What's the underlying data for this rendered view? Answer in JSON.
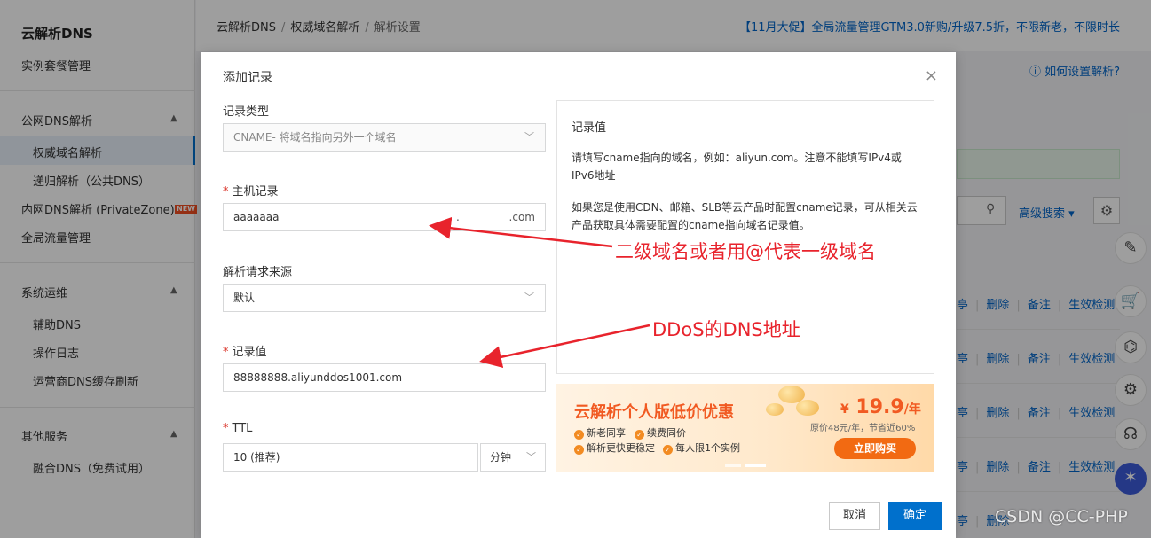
{
  "sidebar": {
    "title": "云解析DNS",
    "items": [
      {
        "label": "实例套餐管理"
      },
      {
        "label": "公网DNS解析"
      },
      {
        "label": "权威域名解析"
      },
      {
        "label": "递归解析（公共DNS）"
      },
      {
        "label": "内网DNS解析 (PrivateZone)"
      },
      {
        "label": "全局流量管理"
      },
      {
        "label": "系统运维"
      },
      {
        "label": "辅助DNS"
      },
      {
        "label": "操作日志"
      },
      {
        "label": "运营商DNS缓存刷新"
      },
      {
        "label": "其他服务"
      },
      {
        "label": "融合DNS（免费试用）"
      }
    ],
    "new_badge": "NEW"
  },
  "topbar": {
    "breadcrumb": [
      "云解析DNS",
      "权威域名解析",
      "解析设置"
    ],
    "promo": "【11月大促】全局流量管理GTM3.0新购/升级7.5折，不限新老，不限时长"
  },
  "page": {
    "howto": "如何设置解析?",
    "advanced_search": "高级搜索",
    "row_actions": [
      "删除",
      "备注",
      "生效检测"
    ],
    "row_partial": "亭"
  },
  "dialog": {
    "title": "添加记录",
    "close": "×",
    "record_type": {
      "label": "记录类型",
      "value": "CNAME- 将域名指向另外一个域名"
    },
    "host": {
      "label": "主机记录",
      "value": "aaaaaaa",
      "dot": ".",
      "suffix": ".com"
    },
    "source": {
      "label": "解析请求来源",
      "value": "默认"
    },
    "record_value": {
      "label": "记录值",
      "value": "88888888.aliyunddos1001.com"
    },
    "ttl": {
      "label": "TTL",
      "value": "10 (推荐)",
      "unit": "分钟"
    },
    "info": {
      "title": "记录值",
      "p1": "请填写cname指向的域名，例如：aliyun.com。注意不能填写IPv4或IPv6地址",
      "p2": "如果您是使用CDN、邮箱、SLB等云产品时配置cname记录，可从相关云产品获取具体需要配置的cname指向域名记录值。"
    },
    "ad": {
      "title": "云解析个人版低价优惠",
      "features": [
        "新老同享",
        "续费同价",
        "解析更快更稳定",
        "每人限1个实例"
      ],
      "price_symbol": "¥",
      "price": "19.9",
      "price_unit": "/年",
      "original": "原价48元/年，节省近60%",
      "buy": "立即购买"
    },
    "cancel": "取消",
    "ok": "确定"
  },
  "annotations": {
    "a1": "二级域名或者用@代表一级域名",
    "a2": "DDoS的DNS地址"
  },
  "watermark": "CSDN @CC-PHP"
}
